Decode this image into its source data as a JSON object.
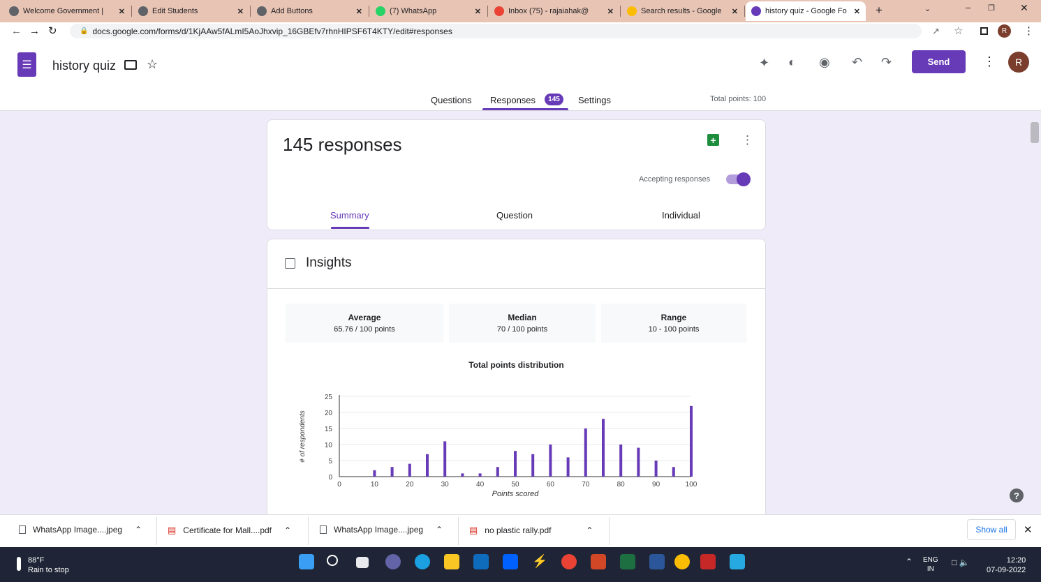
{
  "browser": {
    "tabs": [
      {
        "label": "Welcome Government |",
        "color": "#5f6368"
      },
      {
        "label": "Edit Students",
        "color": "#5f6368"
      },
      {
        "label": "Add Buttons",
        "color": "#5f6368"
      },
      {
        "label": "(7) WhatsApp",
        "color": "#25d366"
      },
      {
        "label": "Inbox (75) - rajaiahak@",
        "color": "#ea4335"
      },
      {
        "label": "Search results - Google",
        "color": "#fbbc04"
      },
      {
        "label": "history quiz - Google Fo",
        "color": "#673ab7"
      }
    ],
    "new_tab": "+",
    "url": "docs.google.com/forms/d/1KjAAw5fALmI5AoJhxvip_16GBEfv7rhnHIPSF6T4KTY/edit#responses",
    "profile_initial": "R"
  },
  "header": {
    "title": "history quiz",
    "send_label": "Send",
    "avatar_initial": "R",
    "tabs": {
      "questions": "Questions",
      "responses": "Responses",
      "responses_count": "145",
      "settings": "Settings"
    },
    "total_points": "Total points: 100"
  },
  "summary": {
    "count_label": "145 responses",
    "accepting_label": "Accepting responses",
    "subtabs": {
      "summary": "Summary",
      "question": "Question",
      "individual": "Individual"
    }
  },
  "insights": {
    "title": "Insights",
    "stats": [
      {
        "label": "Average",
        "value": "65.76 / 100 points"
      },
      {
        "label": "Median",
        "value": "70 / 100 points"
      },
      {
        "label": "Range",
        "value": "10 - 100 points"
      }
    ]
  },
  "chart_data": {
    "type": "bar",
    "title": "Total points distribution",
    "xlabel": "Points scored",
    "ylabel": "# of respondents",
    "x": [
      10,
      15,
      20,
      25,
      30,
      35,
      40,
      45,
      50,
      55,
      60,
      65,
      70,
      75,
      80,
      85,
      90,
      95,
      100
    ],
    "values": [
      2,
      3,
      4,
      7,
      11,
      1,
      1,
      3,
      8,
      7,
      10,
      6,
      15,
      18,
      10,
      9,
      5,
      3,
      22
    ],
    "xticks": [
      0,
      10,
      20,
      30,
      40,
      50,
      60,
      70,
      80,
      90,
      100
    ],
    "yticks": [
      0,
      5,
      10,
      15,
      20,
      25
    ],
    "xlim": [
      0,
      100
    ],
    "ylim": [
      0,
      25
    ],
    "bar_color": "#673ab7",
    "grid": true
  },
  "downloads": {
    "items": [
      "WhatsApp Image....jpeg",
      "Certificate for Mall....pdf",
      "WhatsApp Image....jpeg",
      "no plastic rally.pdf"
    ],
    "show_all": "Show all"
  },
  "taskbar": {
    "weather_temp": "88°F",
    "weather_desc": "Rain to stop",
    "lang": "ENG",
    "region": "IN",
    "time": "12:20",
    "date": "07-09-2022"
  }
}
